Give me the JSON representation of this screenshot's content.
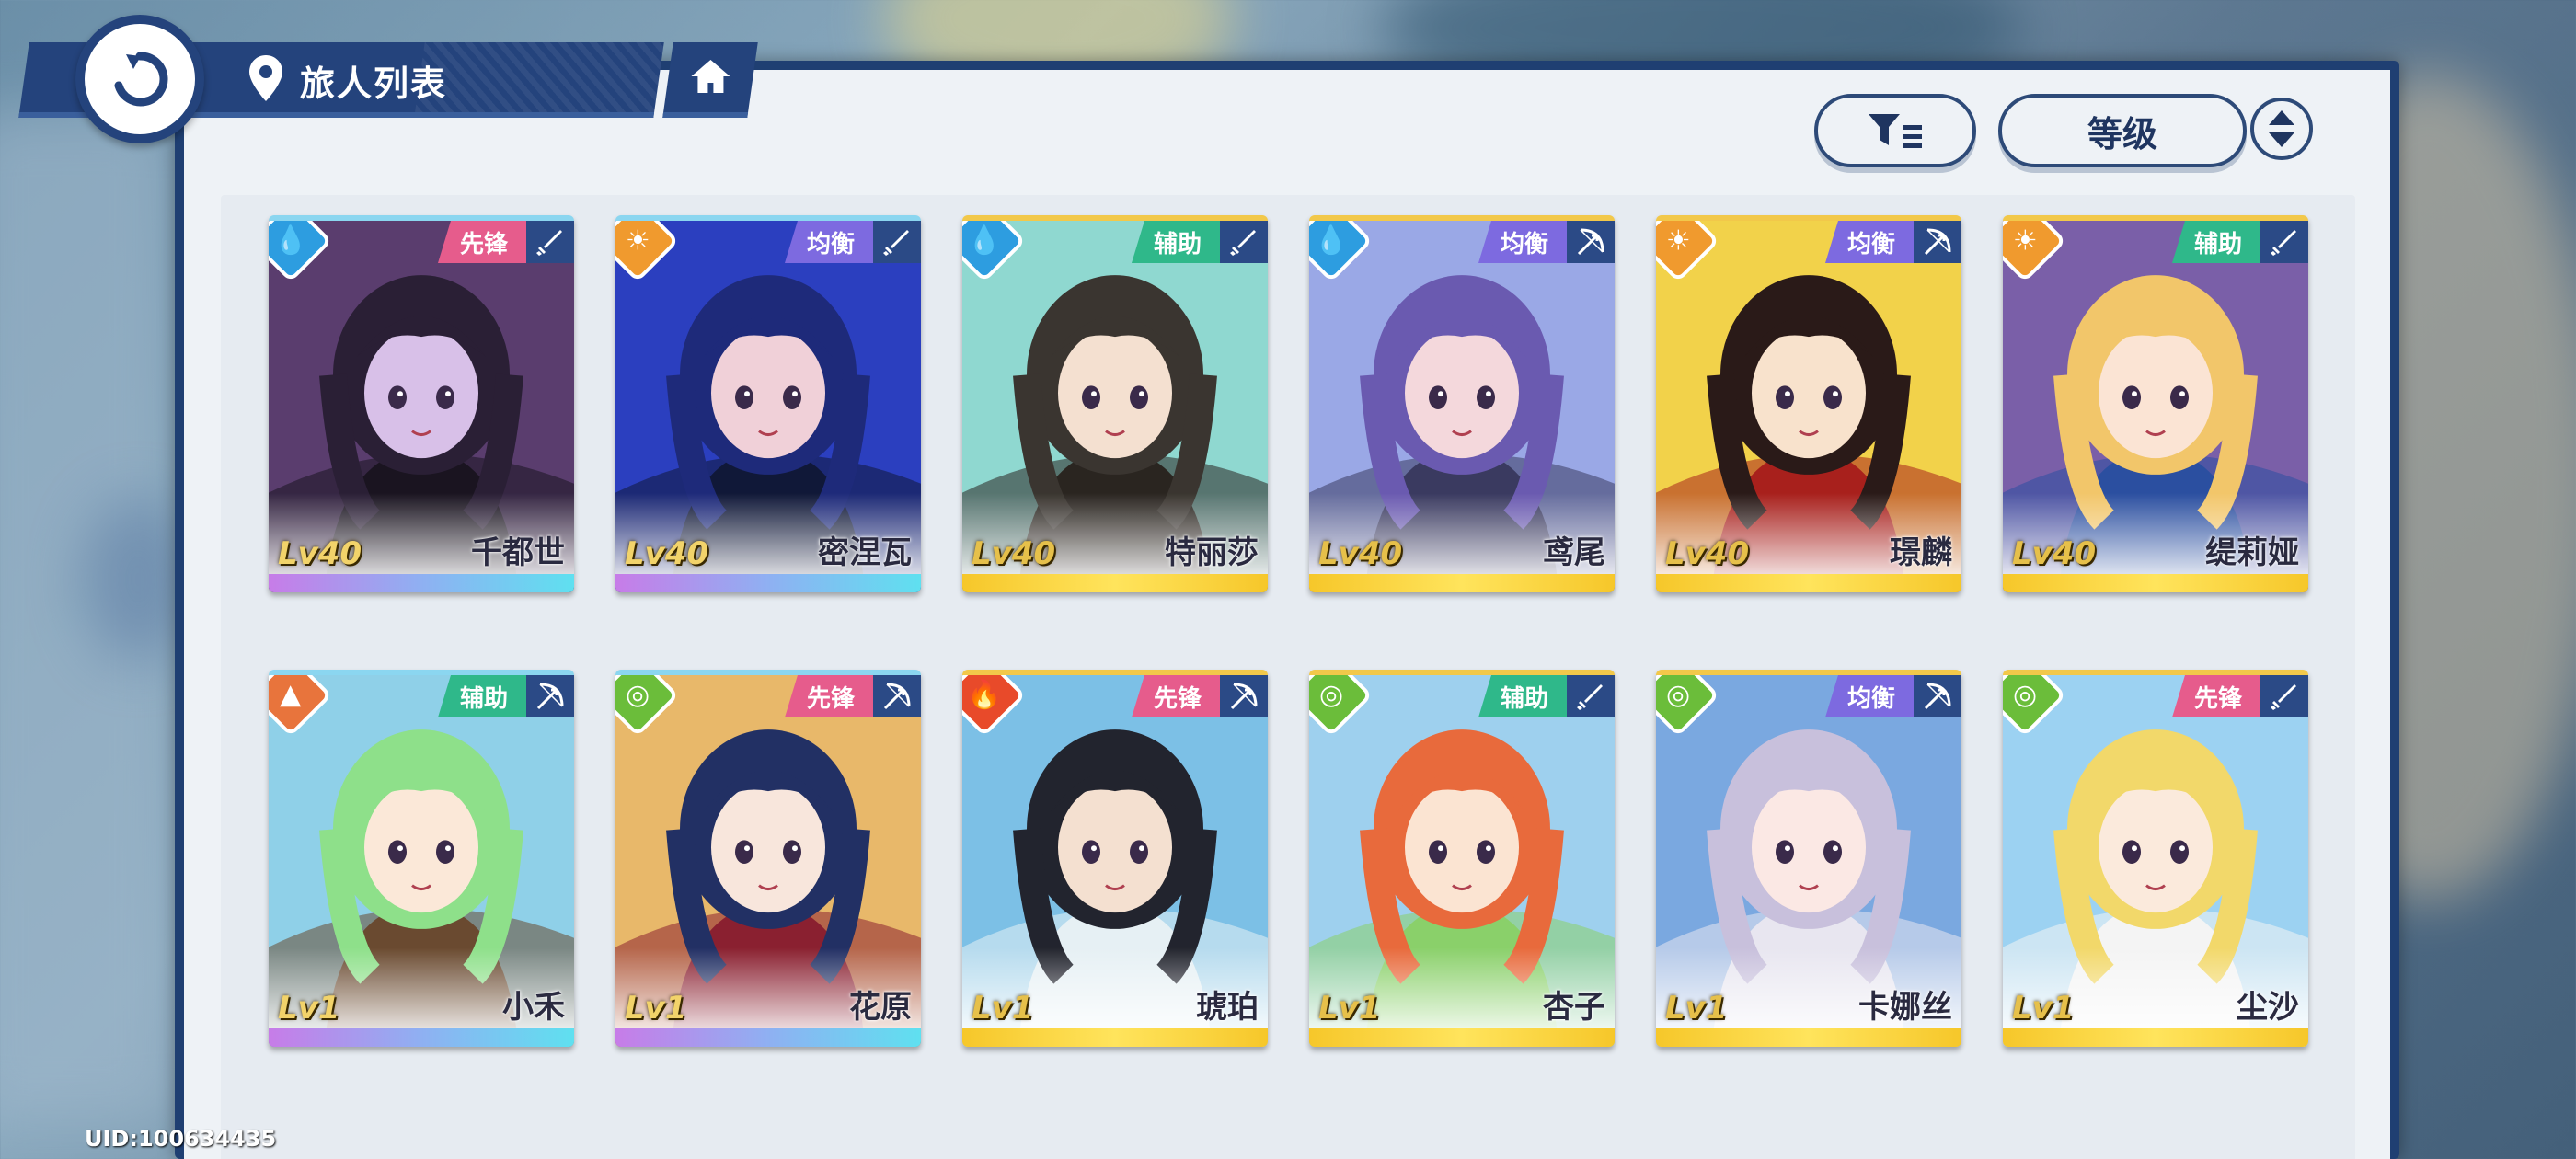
{
  "header": {
    "title": "旅人列表",
    "back_icon": "back-arrow-icon",
    "location_icon": "location-pin-icon",
    "home_icon": "home-icon"
  },
  "sort": {
    "filter_icon": "filter-icon",
    "sort_label": "等级",
    "order_icon": "sort-order-icon"
  },
  "colors": {
    "header_blue": "#24437c",
    "panel_bg": "#eef2f6",
    "role_vanguard": "#e65c8c",
    "role_balance": "#7d6ae0",
    "role_support": "#2fb88a",
    "level_gold": "#e6c04a"
  },
  "characters": [
    {
      "name": "千都世",
      "level": "Lv40",
      "role": "先锋",
      "element": "water",
      "weapon": "sword",
      "rarity": "purple"
    },
    {
      "name": "密涅瓦",
      "level": "Lv40",
      "role": "均衡",
      "element": "sun",
      "weapon": "sword",
      "rarity": "purple"
    },
    {
      "name": "特丽莎",
      "level": "Lv40",
      "role": "辅助",
      "element": "water",
      "weapon": "sword",
      "rarity": "gold"
    },
    {
      "name": "鸢尾",
      "level": "Lv40",
      "role": "均衡",
      "element": "water",
      "weapon": "bow",
      "rarity": "gold"
    },
    {
      "name": "璟麟",
      "level": "Lv40",
      "role": "均衡",
      "element": "sun",
      "weapon": "bow",
      "rarity": "gold"
    },
    {
      "name": "缇莉娅",
      "level": "Lv40",
      "role": "辅助",
      "element": "sun",
      "weapon": "sword",
      "rarity": "gold"
    },
    {
      "name": "小禾",
      "level": "Lv1",
      "role": "辅助",
      "element": "earth",
      "weapon": "bow",
      "rarity": "purple"
    },
    {
      "name": "花原",
      "level": "Lv1",
      "role": "先锋",
      "element": "wind",
      "weapon": "bow",
      "rarity": "purple"
    },
    {
      "name": "琥珀",
      "level": "Lv1",
      "role": "先锋",
      "element": "fire",
      "weapon": "bow",
      "rarity": "gold"
    },
    {
      "name": "杏子",
      "level": "Lv1",
      "role": "辅助",
      "element": "wind",
      "weapon": "sword",
      "rarity": "gold"
    },
    {
      "name": "卡娜丝",
      "level": "Lv1",
      "role": "均衡",
      "element": "wind",
      "weapon": "bow",
      "rarity": "gold"
    },
    {
      "name": "尘沙",
      "level": "Lv1",
      "role": "先锋",
      "element": "wind",
      "weapon": "sword",
      "rarity": "gold"
    }
  ],
  "footer": {
    "uid": "UID:100634435"
  }
}
